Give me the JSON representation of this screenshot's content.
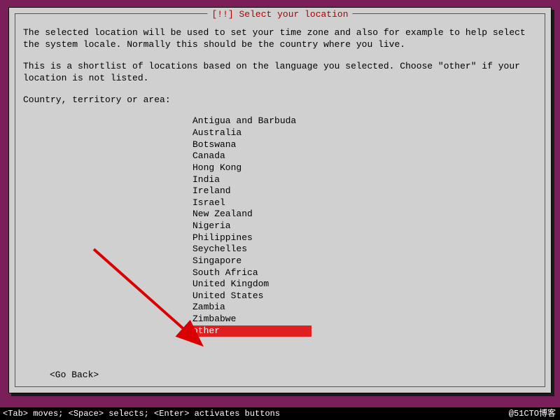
{
  "dialog": {
    "title": "[!!] Select your location",
    "paragraph1": "The selected location will be used to set your time zone and also for example to help select the system locale. Normally this should be the country where you live.",
    "paragraph2": "This is a shortlist of locations based on the language you selected. Choose \"other\" if your location is not listed.",
    "prompt": "Country, territory or area:",
    "items": [
      {
        "label": "Antigua and Barbuda",
        "selected": false
      },
      {
        "label": "Australia",
        "selected": false
      },
      {
        "label": "Botswana",
        "selected": false
      },
      {
        "label": "Canada",
        "selected": false
      },
      {
        "label": "Hong Kong",
        "selected": false
      },
      {
        "label": "India",
        "selected": false
      },
      {
        "label": "Ireland",
        "selected": false
      },
      {
        "label": "Israel",
        "selected": false
      },
      {
        "label": "New Zealand",
        "selected": false
      },
      {
        "label": "Nigeria",
        "selected": false
      },
      {
        "label": "Philippines",
        "selected": false
      },
      {
        "label": "Seychelles",
        "selected": false
      },
      {
        "label": "Singapore",
        "selected": false
      },
      {
        "label": "South Africa",
        "selected": false
      },
      {
        "label": "United Kingdom",
        "selected": false
      },
      {
        "label": "United States",
        "selected": false
      },
      {
        "label": "Zambia",
        "selected": false
      },
      {
        "label": "Zimbabwe",
        "selected": false
      },
      {
        "label": "other",
        "selected": true
      }
    ],
    "go_back": "<Go Back>"
  },
  "footer": {
    "hint": "<Tab> moves; <Space> selects; <Enter> activates buttons",
    "watermark": "@51CTO博客"
  },
  "colors": {
    "background": "#7a1f5a",
    "dialog_bg": "#d0d0d0",
    "title_color": "#b00000",
    "selected_bg": "#e02020",
    "arrow_color": "#d80000"
  }
}
